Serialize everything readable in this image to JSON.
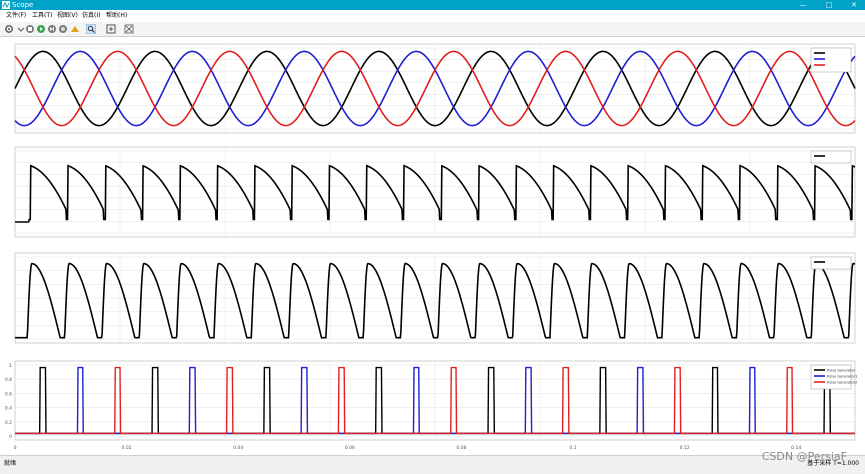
{
  "window": {
    "title": "Scope",
    "minimize": "—",
    "maximize": "□",
    "close": "✕"
  },
  "menu": [
    "文件(F)",
    "工具(T)",
    "视图(V)",
    "仿真(I)",
    "帮助(H)"
  ],
  "toolbar": {
    "icons": [
      "gear-icon",
      "stop-icon",
      "run-icon",
      "step-forward-icon",
      "record-icon",
      "highlight-icon",
      "zoom-icon",
      "fit-icon",
      "cursor-icon"
    ]
  },
  "colors": {
    "black": "#000000",
    "blue": "#1f1fd4",
    "red": "#e02020",
    "grid": "#e6e6e6",
    "axis": "#b4b4b4",
    "titlebar": "#00a2c7"
  },
  "chart_data": [
    {
      "type": "line",
      "description": "three-phase sine voltages",
      "x_range": [
        0,
        0.15
      ],
      "ylim": [
        -300,
        300
      ],
      "y_ticks": [
        "",
        "",
        "",
        "",
        "",
        "",
        "",
        ""
      ],
      "period_s": 0.02,
      "amplitude": 250,
      "series": [
        {
          "name": "",
          "color": "black",
          "phase_deg": 0
        },
        {
          "name": "",
          "color": "blue",
          "phase_deg": -120
        },
        {
          "name": "",
          "color": "red",
          "phase_deg": 120
        }
      ],
      "legend": "top-right",
      "grid": true
    },
    {
      "type": "line",
      "description": "rectified output with firing notches",
      "x_range": [
        0,
        0.15
      ],
      "ylim": [
        -60,
        300
      ],
      "y_ticks": [
        "",
        "",
        "",
        "",
        "",
        "",
        "",
        ""
      ],
      "series": [
        {
          "name": "",
          "color": "black"
        }
      ],
      "legend": "top-right",
      "grid": true
    },
    {
      "type": "line",
      "description": "load current pulses",
      "x_range": [
        0,
        0.15
      ],
      "ylim": [
        -2,
        32
      ],
      "y_ticks": [
        "",
        "",
        "",
        "",
        "",
        "",
        ""
      ],
      "series": [
        {
          "name": "",
          "color": "black"
        }
      ],
      "legend": "top-right",
      "grid": true
    },
    {
      "type": "line",
      "description": "gate pulses",
      "x_range": [
        0,
        0.15
      ],
      "ylim": [
        -0.1,
        1.1
      ],
      "y_ticks": [
        "0",
        "0.2",
        "0.4",
        "0.6",
        "0.8",
        "1"
      ],
      "x_ticks": [
        "0",
        "0.02",
        "0.04",
        "0.06",
        "0.08",
        "0.1",
        "0.12",
        "0.14"
      ],
      "series": [
        {
          "name": "Pulse Generator",
          "color": "black"
        },
        {
          "name": "Pulse Generator1",
          "color": "blue"
        },
        {
          "name": "Pulse Generator2",
          "color": "red"
        }
      ],
      "legend": "top-right",
      "grid": true
    }
  ],
  "status": {
    "left": "就绪",
    "right": "基于采样  T=1.000"
  },
  "watermark": "CSDN @PersiaF"
}
